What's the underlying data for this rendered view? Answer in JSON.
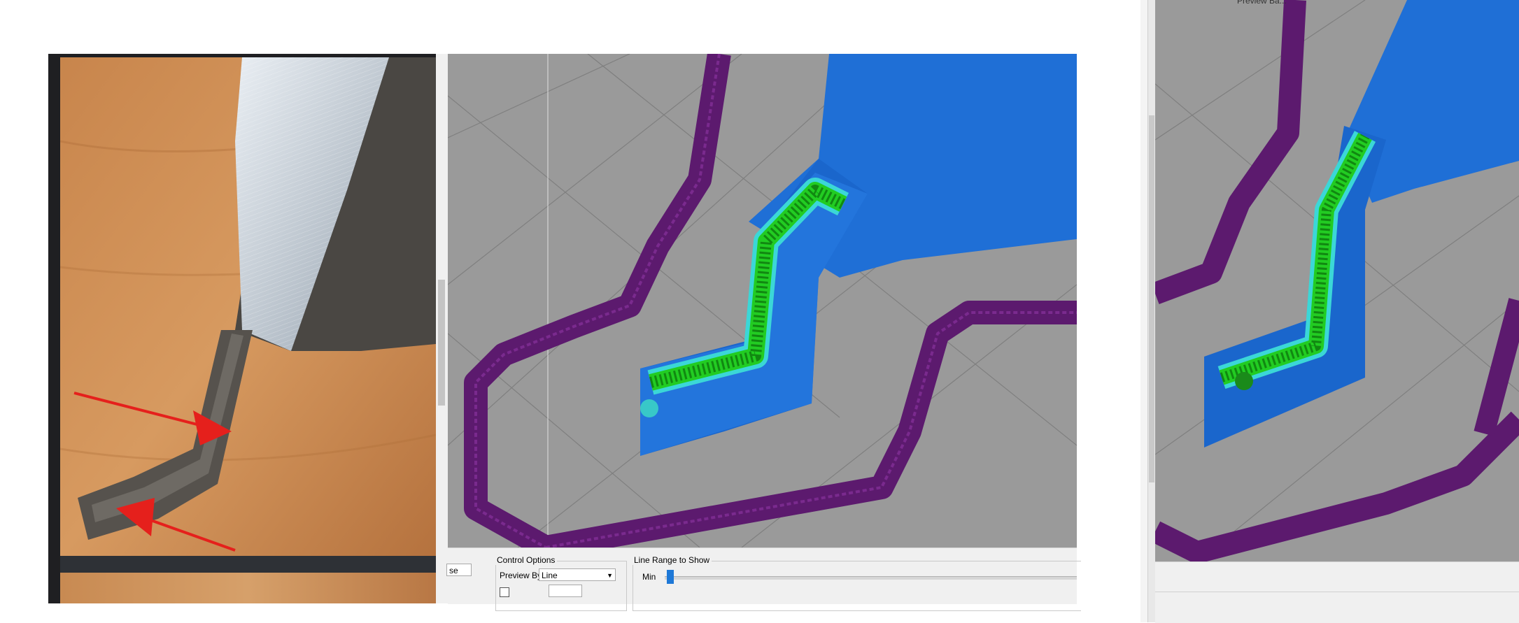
{
  "mid_controls": {
    "control_options_title": "Control Options",
    "preview_by_label": "Preview By",
    "preview_by_value": "Line",
    "line_range_title": "Line Range to Show",
    "min_label": "Min",
    "partial_button_label": "se"
  },
  "right_window": {
    "caption": "Preview Ba..."
  },
  "photo": {
    "annotation_arrow_color": "#e5201c"
  },
  "colors": {
    "outer_wall": "#5c1a6e",
    "inner_wall": "#1f6fd6",
    "skin": "#22cc22",
    "highlight": "#40e0e0",
    "viewport_bg": "#9a9a9a"
  }
}
